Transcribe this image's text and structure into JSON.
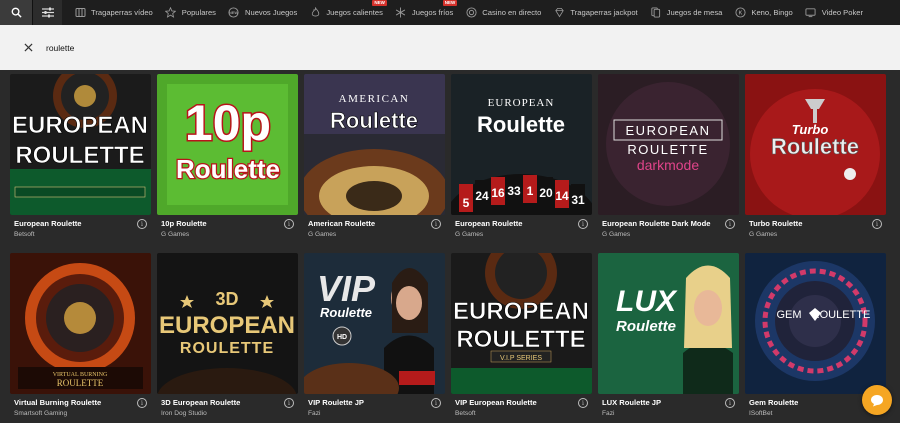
{
  "nav": {
    "items": [
      {
        "label": "Tragaperras vídeo",
        "icon": "slot-icon",
        "new": false
      },
      {
        "label": "Populares",
        "icon": "star-icon",
        "new": false
      },
      {
        "label": "Nuevos Juegos",
        "icon": "new-games-icon",
        "new": false
      },
      {
        "label": "Juegos calientes",
        "icon": "flame-icon",
        "new": true
      },
      {
        "label": "Juegos fríos",
        "icon": "snowflake-icon",
        "new": true
      },
      {
        "label": "Casino en directo",
        "icon": "live-casino-icon",
        "new": false
      },
      {
        "label": "Tragaperras jackpot",
        "icon": "diamond-icon",
        "new": false
      },
      {
        "label": "Juegos de mesa",
        "icon": "table-games-icon",
        "new": false
      },
      {
        "label": "Keno, Bingo",
        "icon": "keno-icon",
        "new": false
      },
      {
        "label": "Video Poker",
        "icon": "video-poker-icon",
        "new": false
      }
    ],
    "new_badge": "NEW"
  },
  "search": {
    "value": "roulette"
  },
  "games": [
    {
      "name": "European Roulette",
      "provider": "Betsoft",
      "thumb_text": [
        "EUROPEAN",
        "ROULETTE"
      ],
      "art": "wheel-board"
    },
    {
      "name": "10p Roulette",
      "provider": "G Games",
      "thumb_text": [
        "10p",
        "Roulette"
      ],
      "art": "green"
    },
    {
      "name": "American Roulette",
      "provider": "G Games",
      "thumb_text": [
        "AMERICAN",
        "Roulette"
      ],
      "art": "american"
    },
    {
      "name": "European Roulette",
      "provider": "G Games",
      "thumb_text": [
        "EUROPEAN",
        "Roulette"
      ],
      "art": "numbers"
    },
    {
      "name": "European Roulette Dark Mode",
      "provider": "G Games",
      "thumb_text": [
        "EUROPEAN",
        "ROULETTE",
        "darkmode"
      ],
      "art": "dark"
    },
    {
      "name": "Turbo Roulette",
      "provider": "G Games",
      "thumb_text": [
        "Turbo",
        "Roulette"
      ],
      "art": "turbo"
    },
    {
      "name": "Virtual Burning Roulette",
      "provider": "Smartsoft Gaming",
      "thumb_text": [
        "VIRTUAL BURNING",
        "ROULETTE"
      ],
      "art": "burning"
    },
    {
      "name": "3D European Roulette",
      "provider": "Iron Dog Studio",
      "thumb_text": [
        "3D",
        "EUROPEAN",
        "ROULETTE"
      ],
      "art": "3d"
    },
    {
      "name": "VIP Roulette JP",
      "provider": "Fazi",
      "thumb_text": [
        "VIP",
        "Roulette",
        "HD"
      ],
      "art": "vip"
    },
    {
      "name": "VIP European Roulette",
      "provider": "Betsoft",
      "thumb_text": [
        "EUROPEAN",
        "ROULETTE",
        "V.I.P SERIES"
      ],
      "art": "vip-euro"
    },
    {
      "name": "LUX Roulette JP",
      "provider": "Fazi",
      "thumb_text": [
        "LUX",
        "Roulette"
      ],
      "art": "lux"
    },
    {
      "name": "Gem Roulette",
      "provider": "ISoftBet",
      "thumb_text": [
        "GEM",
        "ROULETTE"
      ],
      "art": "gem"
    }
  ],
  "colors": {
    "accent": "#f5a623",
    "badge": "#d4312b",
    "nav_bg": "#1e1e1e",
    "page_bg": "#2a2a2a",
    "search_bg": "#f2f2f2"
  }
}
